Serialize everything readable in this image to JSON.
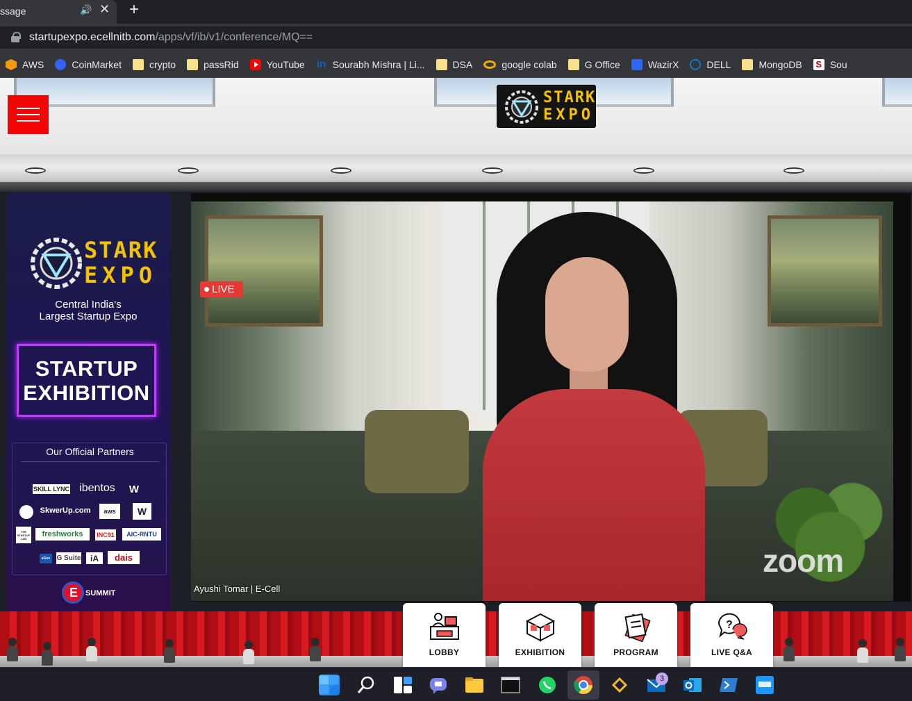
{
  "browser": {
    "tab_title": "ssage",
    "tab_audio_icon": "speaker-icon",
    "tab_close_icon": "close-icon",
    "new_tab_icon": "plus-icon",
    "url_host": "startupexpo.ecellnitb.com",
    "url_path": "/apps/vf/ib/v1/conference/MQ=="
  },
  "bookmarks": [
    {
      "label": "AWS",
      "icon": "aws-icon"
    },
    {
      "label": "CoinMarket",
      "icon": "coinmarketcap-icon"
    },
    {
      "label": "crypto",
      "icon": "folder-icon"
    },
    {
      "label": "passRid",
      "icon": "folder-icon"
    },
    {
      "label": "YouTube",
      "icon": "youtube-icon"
    },
    {
      "label": "Sourabh Mishra | Li...",
      "icon": "linkedin-icon"
    },
    {
      "label": "DSA",
      "icon": "folder-icon"
    },
    {
      "label": "google colab",
      "icon": "colab-icon"
    },
    {
      "label": "G Office",
      "icon": "folder-icon"
    },
    {
      "label": "WazirX",
      "icon": "wazirx-icon"
    },
    {
      "label": "DELL",
      "icon": "dell-icon"
    },
    {
      "label": "MongoDB",
      "icon": "folder-icon"
    },
    {
      "label": "Sou",
      "icon": "s-icon"
    }
  ],
  "venue": {
    "brand_top": "STARK",
    "brand_bottom": "EXPO",
    "tagline_line1": "Central India's",
    "tagline_line2": "Largest Startup Expo",
    "exhibit_line1": "STARTUP",
    "exhibit_line2": "EXHIBITION",
    "partners_title": "Our Official Partners",
    "partners": [
      "SKILL LYNC",
      "ibentos",
      "W",
      "SkwerUp.com",
      "aws",
      "W",
      "THE STARTUP LAB",
      "freshworks",
      "INC91",
      "AIC-RNTU",
      "eGov",
      "G Suite",
      "iA",
      "dais"
    ],
    "esummit_letter": "E",
    "esummit_word": "SUMMIT",
    "live_label": "LIVE",
    "speaker_name": "Ayushi Tomar | E-Cell",
    "zoom_watermark": "zoom",
    "accent_red": "#f30505",
    "accent_purple": "#c23bff",
    "brand_yellow": "#f3c300"
  },
  "nav": [
    {
      "label": "LOBBY",
      "icon": "lobby-desk-icon"
    },
    {
      "label": "EXHIBITION",
      "icon": "exhibition-booth-icon"
    },
    {
      "label": "PROGRAM",
      "icon": "program-schedule-icon"
    },
    {
      "label": "LIVE Q&A",
      "icon": "chat-question-icon"
    }
  ],
  "taskbar": {
    "mail_badge": "3",
    "apps": [
      "windows-start-icon",
      "search-icon",
      "widgets-icon",
      "teams-chat-icon",
      "file-explorer-icon",
      "terminal-icon",
      "whatsapp-icon",
      "chrome-icon",
      "binance-icon",
      "mail-icon",
      "outlook-icon",
      "powershell-icon",
      "prime-video-icon"
    ]
  }
}
